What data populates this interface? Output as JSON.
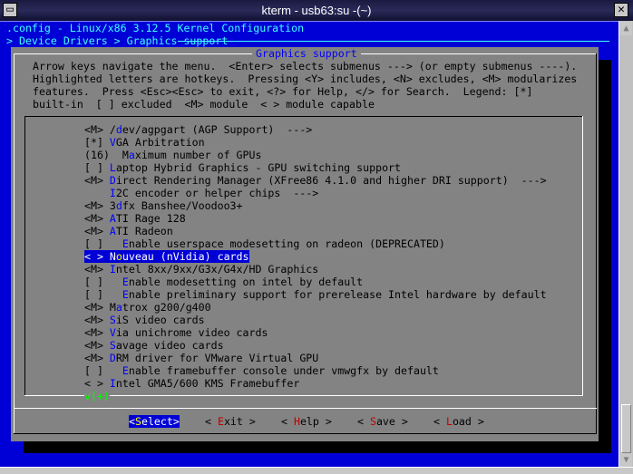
{
  "window": {
    "title": "kterm - usb63:su -(~)",
    "menu_icon": "window-menu-icon",
    "close_icon": "close-icon"
  },
  "header": {
    "config_title": ".config - Linux/x86 3.12.5 Kernel Configuration",
    "breadcrumb": "> Device Drivers > Graphics support"
  },
  "dialog": {
    "title": "Graphics support",
    "help_lines": [
      "Arrow keys navigate the menu.  <Enter> selects submenus ---> (or empty submenus ----).",
      "Highlighted letters are hotkeys.  Pressing <Y> includes, <N> excludes, <M> modularizes",
      "features.  Press <Esc><Esc> to exit, <?> for Help, </> for Search.  Legend: [*]",
      "built-in  [ ] excluded  <M> module  < > module capable"
    ],
    "items": [
      {
        "state": "<M> ",
        "pre": "/",
        "key": "d",
        "post": "ev/agpgart (AGP Support)  --->"
      },
      {
        "state": "[*] ",
        "pre": "",
        "key": "V",
        "post": "GA Arbitration"
      },
      {
        "state": "(16)  ",
        "pre": "M",
        "key": "a",
        "post": "ximum number of GPUs"
      },
      {
        "state": "[ ] ",
        "pre": "",
        "key": "L",
        "post": "aptop Hybrid Graphics - GPU switching support"
      },
      {
        "state": "<M> ",
        "pre": "",
        "key": "D",
        "post": "irect Rendering Manager (XFree86 4.1.0 and higher DRI support)  --->"
      },
      {
        "state": "    ",
        "pre": "",
        "key": "I",
        "post": "2C encoder or helper chips  --->"
      },
      {
        "state": "<M> ",
        "pre": "3",
        "key": "d",
        "post": "fx Banshee/Voodoo3+"
      },
      {
        "state": "<M> ",
        "pre": "",
        "key": "A",
        "post": "TI Rage 128"
      },
      {
        "state": "<M> ",
        "pre": "",
        "key": "A",
        "post": "TI Radeon"
      },
      {
        "state": "[ ]   ",
        "pre": "",
        "key": "E",
        "post": "nable userspace modesetting on radeon (DEPRECATED)"
      },
      {
        "state": "< > ",
        "pre": "N",
        "key": "o",
        "post": "uveau (nVidia) cards",
        "selected": true
      },
      {
        "state": "<M> ",
        "pre": "",
        "key": "I",
        "post": "ntel 8xx/9xx/G3x/G4x/HD Graphics"
      },
      {
        "state": "[ ]   ",
        "pre": "",
        "key": "E",
        "post": "nable modesetting on intel by default"
      },
      {
        "state": "[ ]   ",
        "pre": "",
        "key": "E",
        "post": "nable preliminary support for prerelease Intel hardware by default"
      },
      {
        "state": "<M> ",
        "pre": "M",
        "key": "a",
        "post": "trox g200/g400"
      },
      {
        "state": "<M> ",
        "pre": "",
        "key": "S",
        "post": "iS video cards"
      },
      {
        "state": "<M> ",
        "pre": "",
        "key": "V",
        "post": "ia unichrome video cards"
      },
      {
        "state": "<M> ",
        "pre": "",
        "key": "S",
        "post": "avage video cards"
      },
      {
        "state": "<M> ",
        "pre": "",
        "key": "D",
        "post": "RM driver for VMware Virtual GPU"
      },
      {
        "state": "[ ]   ",
        "pre": "",
        "key": "E",
        "post": "nable framebuffer console under vmwgfx by default"
      },
      {
        "state": "< > ",
        "pre": "",
        "key": "I",
        "post": "ntel GMA5/600 KMS Framebuffer"
      }
    ],
    "more_indicator": "v(+)",
    "buttons": [
      {
        "pre": "<",
        "key": "S",
        "post": "elect>",
        "selected": true
      },
      {
        "pre": "< ",
        "key": "E",
        "post": "xit >"
      },
      {
        "pre": "< ",
        "key": "H",
        "post": "elp >"
      },
      {
        "pre": "< ",
        "key": "S",
        "post": "ave >"
      },
      {
        "pre": "< ",
        "key": "L",
        "post": "oad >"
      }
    ]
  },
  "colors": {
    "terminal_bg": "#0000d6",
    "dialog_bg": "#838383",
    "hotkey": "#0000ff",
    "selected_hotkey": "#ffff00",
    "button_hotkey": "#c00000",
    "more_indicator": "#00ff00",
    "header_text": "#40ffff"
  }
}
